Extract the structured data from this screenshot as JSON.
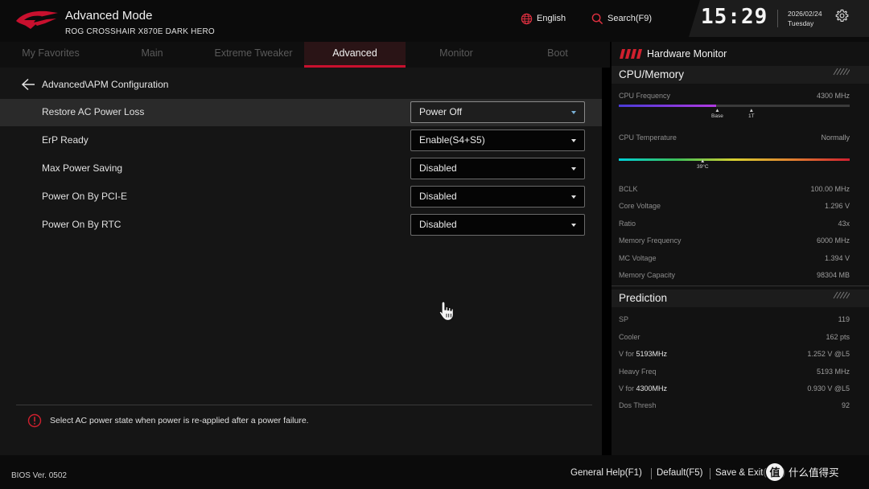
{
  "header": {
    "title": "Advanced Mode",
    "subtitle": "ROG CROSSHAIR X870E DARK HERO",
    "language": "English",
    "search": "Search(F9)",
    "time": "15:29",
    "date": "2026/02/24",
    "day": "Tuesday"
  },
  "tabs": [
    {
      "label": "My Favorites"
    },
    {
      "label": "Main"
    },
    {
      "label": "Extreme Tweaker"
    },
    {
      "label": "Advanced"
    },
    {
      "label": "Monitor"
    },
    {
      "label": "Boot"
    }
  ],
  "active_tab": "Advanced",
  "main": {
    "breadcrumb": "Advanced\\APM Configuration",
    "settings": [
      {
        "label": "Restore AC Power Loss",
        "value": "Power Off"
      },
      {
        "label": "ErP Ready",
        "value": "Enable(S4+S5)"
      },
      {
        "label": "Max Power Saving",
        "value": "Disabled"
      },
      {
        "label": "Power On By PCI-E",
        "value": "Disabled"
      },
      {
        "label": "Power On By RTC",
        "value": "Disabled"
      }
    ],
    "help_text": "Select AC power state when power is re-applied after a power failure."
  },
  "monitor": {
    "title": "Hardware Monitor",
    "cpu_memory": {
      "title": "CPU/Memory",
      "cpu_frequency_label": "CPU Frequency",
      "cpu_frequency_value": "4300 MHz",
      "cpu_frequency_level": 0.42,
      "cpu_frequency_markers": [
        "Base",
        "1T"
      ],
      "cpu_temp_label": "CPU Temperature",
      "cpu_temp_value": "Normally",
      "cpu_temp_marker": "39°C",
      "items": [
        {
          "label": "BCLK",
          "value": "100.00 MHz"
        },
        {
          "label": "Core Voltage",
          "value": "1.296 V"
        },
        {
          "label": "Ratio",
          "value": "43x"
        },
        {
          "label": "Memory Frequency",
          "value": "6000 MHz"
        },
        {
          "label": "MC Voltage",
          "value": "1.394 V"
        },
        {
          "label": "Memory Capacity",
          "value": "98304 MB"
        }
      ]
    },
    "prediction": {
      "title": "Prediction",
      "items": [
        {
          "label": "SP",
          "label_strong": "",
          "value": "119"
        },
        {
          "label": "Cooler",
          "label_strong": "",
          "value": "162 pts"
        },
        {
          "label": "V for ",
          "label_strong": "5193MHz",
          "value": "1.252 V @L5"
        },
        {
          "label": "Heavy Freq",
          "label_strong": "",
          "value": "5193 MHz"
        },
        {
          "label": "V for ",
          "label_strong": "4300MHz",
          "value": "0.930 V @L5"
        },
        {
          "label": "Dos Thresh",
          "label_strong": "",
          "value": "92"
        }
      ]
    }
  },
  "footer": {
    "bios_version": "BIOS Ver. 0502",
    "general_help": "General Help(F1)",
    "default": "Default(F5)",
    "save_exit": "Save & Exit(F10)",
    "watermark_text": "值 什么值得买"
  },
  "colors": {
    "accent": "#c8102e",
    "panel": "#151515",
    "select_caret_focus": "#7ab0d6"
  },
  "icons": {
    "logo": "rog-eye-logo",
    "language": "globe-icon",
    "search": "search-icon",
    "settings": "gear-icon",
    "back": "back-arrow-icon",
    "info": "info-icon",
    "cursor": "hand-cursor-icon"
  }
}
